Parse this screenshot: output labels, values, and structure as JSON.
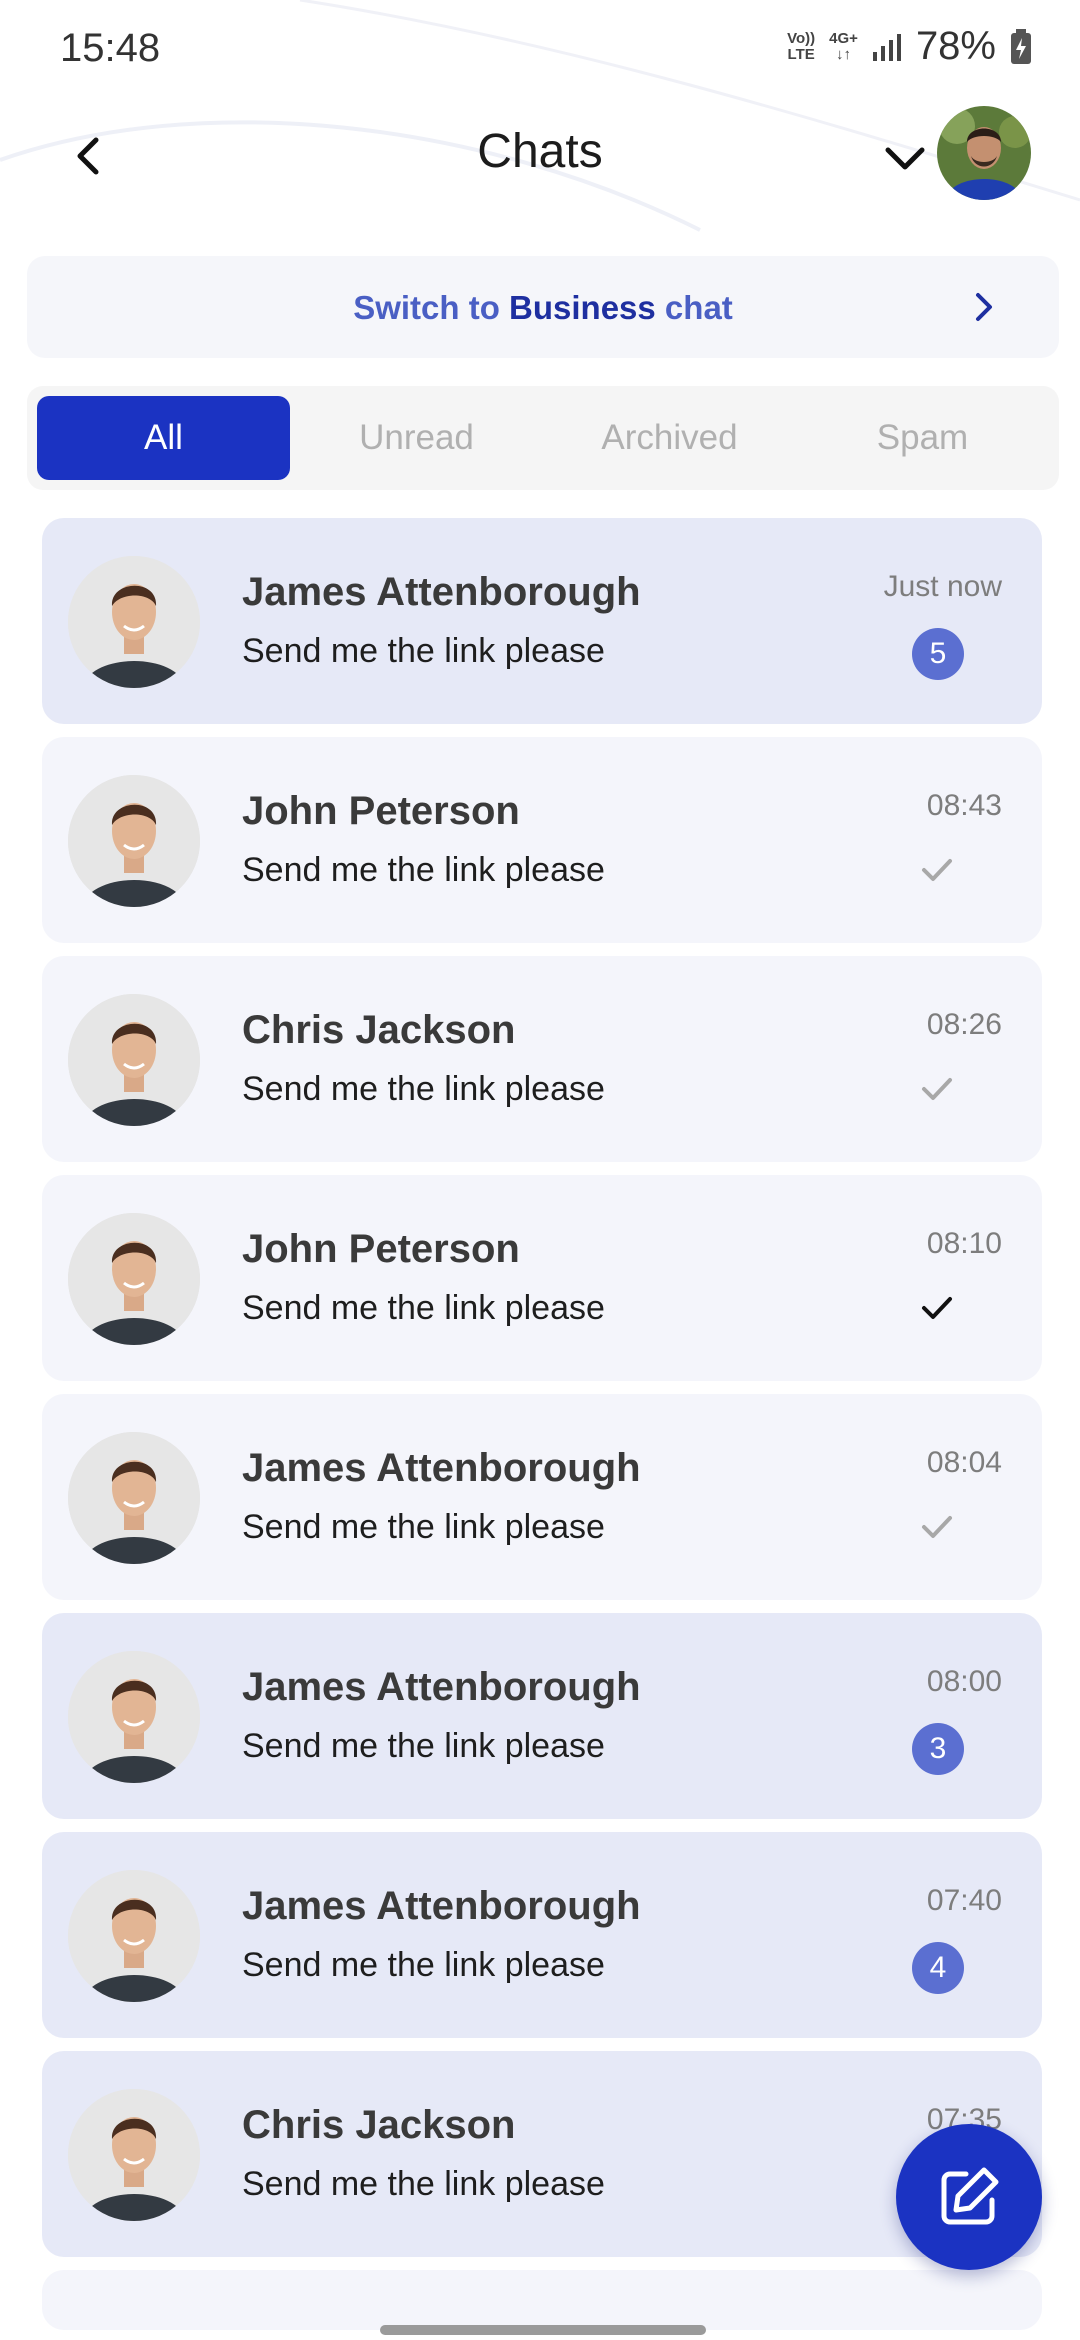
{
  "status_bar": {
    "time": "15:48",
    "network_volte": "Vo)) LTE",
    "network_4g": "4G+",
    "battery": "78%"
  },
  "header": {
    "title": "Chats",
    "icons": {
      "back": "chevron-left-icon",
      "account_menu": "chevron-down-icon"
    }
  },
  "business_banner": {
    "prefix": "Switch to ",
    "strong": "Business",
    "suffix": " chat"
  },
  "tabs": [
    {
      "label": "All",
      "active": true
    },
    {
      "label": "Unread",
      "active": false
    },
    {
      "label": "Archived",
      "active": false
    },
    {
      "label": "Spam",
      "active": false
    }
  ],
  "chats": [
    {
      "name": "James Attenborough",
      "message": "Send me the link please",
      "time": "Just now",
      "unread_count": "5",
      "status": "unread"
    },
    {
      "name": "John Peterson",
      "message": "Send me the link please",
      "time": "08:43",
      "unread_count": "",
      "status": "delivered"
    },
    {
      "name": "Chris Jackson",
      "message": "Send me the link please",
      "time": "08:26",
      "unread_count": "",
      "status": "delivered"
    },
    {
      "name": "John Peterson",
      "message": "Send me the link please",
      "time": "08:10",
      "unread_count": "",
      "status": "read"
    },
    {
      "name": "James Attenborough",
      "message": "Send me the link please",
      "time": "08:04",
      "unread_count": "",
      "status": "delivered"
    },
    {
      "name": "James Attenborough",
      "message": "Send me the link please",
      "time": "08:00",
      "unread_count": "3",
      "status": "unread"
    },
    {
      "name": "James Attenborough",
      "message": "Send me the link please",
      "time": "07:40",
      "unread_count": "4",
      "status": "unread"
    },
    {
      "name": "Chris Jackson",
      "message": "Send me the link please",
      "time": "07:35",
      "unread_count": "",
      "status": "unread"
    }
  ],
  "colors": {
    "accent": "#1b33c2",
    "badge": "#5b6fd1",
    "unread_bg": "#e6e9f7",
    "read_bg": "#f4f5fb",
    "banner_text": "#4a5fc4"
  },
  "fab": {
    "icon": "compose-icon"
  }
}
